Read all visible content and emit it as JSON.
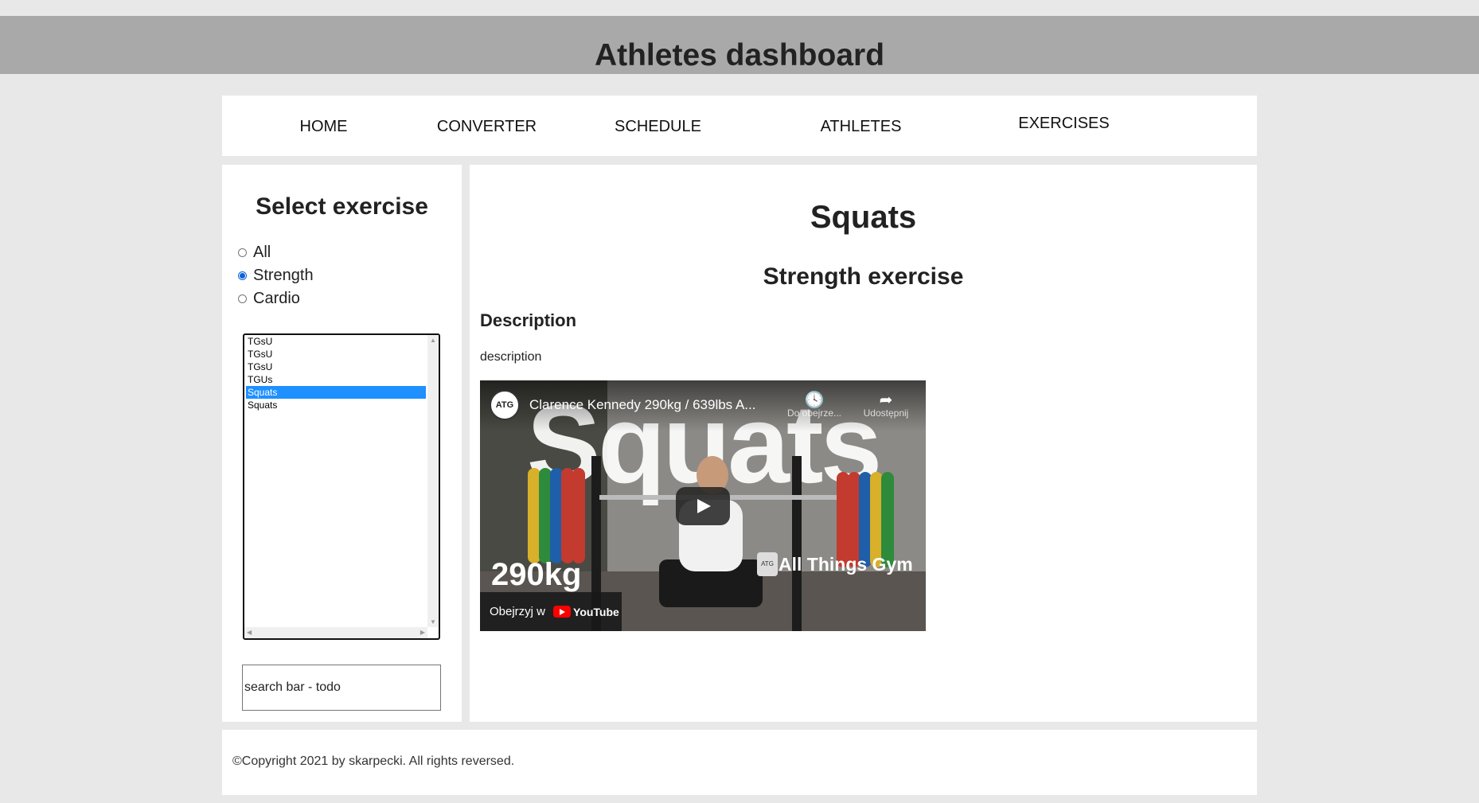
{
  "header": {
    "title": "Athletes dashboard"
  },
  "nav": {
    "items": [
      {
        "label": "HOME"
      },
      {
        "label": "CONVERTER"
      },
      {
        "label": "SCHEDULE"
      },
      {
        "label": "ATHLETES"
      },
      {
        "label": "EXERCISES"
      }
    ]
  },
  "sidebar": {
    "title": "Select exercise",
    "filters": [
      {
        "label": "All",
        "checked": false
      },
      {
        "label": "Strength",
        "checked": true
      },
      {
        "label": "Cardio",
        "checked": false
      }
    ],
    "exercise_list": [
      "TGsU",
      "TGsU",
      "TGsU",
      "TGUs",
      "Squats",
      "Squats"
    ],
    "selected_index": 4,
    "search": {
      "value": "search bar - todo"
    }
  },
  "main": {
    "title": "Squats",
    "subtitle": "Strength exercise",
    "description_heading": "Description",
    "description_text": "description",
    "video": {
      "channel_avatar": "ATG",
      "title": "Clarence Kennedy 290kg / 639lbs A...",
      "watch_later_label": "Do obejrze...",
      "share_label": "Udostępnij",
      "overlay_word": "Squats",
      "weight_text": "290kg",
      "brand_text": "All Things Gym",
      "brand_logo": "ATG",
      "watch_on_label": "Obejrzyj w",
      "youtube_label": "YouTube"
    }
  },
  "footer": {
    "text": "©Copyright 2021 by skarpecki. All rights reversed."
  }
}
